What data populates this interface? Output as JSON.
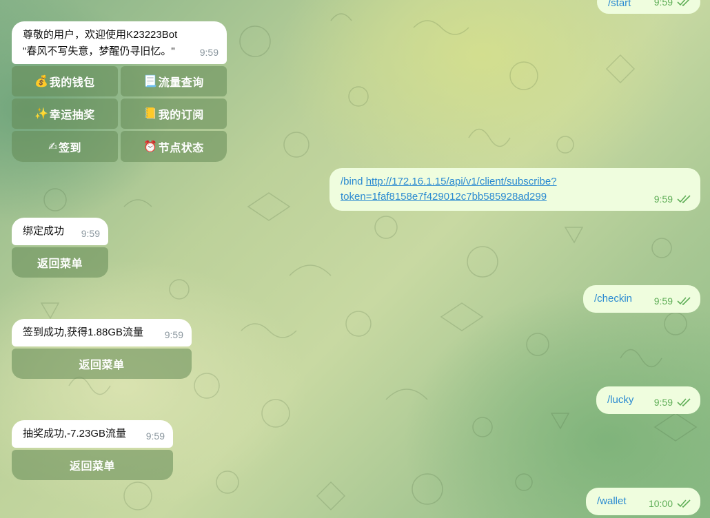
{
  "welcome": {
    "line1": "尊敬的用户，欢迎使用K23223Bot",
    "line2": "\"春风不写失意，梦醒仍寻旧忆。\"",
    "time": "9:59"
  },
  "menu": {
    "wallet": {
      "emoji": "💰",
      "label": "我的钱包"
    },
    "traffic": {
      "emoji": "📃",
      "label": "流量查询"
    },
    "lucky": {
      "emoji": "✨",
      "label": "幸运抽奖"
    },
    "subscription": {
      "emoji": "📒",
      "label": "我的订阅"
    },
    "checkin": {
      "emoji": "✍",
      "label": "签到"
    },
    "nodes": {
      "emoji": "⏰",
      "label": "节点状态"
    }
  },
  "messages": {
    "start": {
      "text": "/start",
      "time": "9:59"
    },
    "bind": {
      "prefix": "/bind ",
      "url_line1": "http://172.16.1.15/api/v1/client/subscribe?",
      "url_line2": "token=1faf8158e7f429012c7bb585928ad299",
      "time": "9:59"
    },
    "bind_ok": {
      "text": "绑定成功",
      "time": "9:59"
    },
    "checkin_cmd": {
      "text": "/checkin",
      "time": "9:59"
    },
    "checkin_ok": {
      "text": "签到成功,获得1.88GB流量",
      "time": "9:59"
    },
    "lucky_cmd": {
      "text": "/lucky",
      "time": "9:59"
    },
    "lucky_ok": {
      "text": "抽奖成功,-7.23GB流量",
      "time": "9:59"
    },
    "wallet_cmd": {
      "text": "/wallet",
      "time": "10:00"
    }
  },
  "back_label": "返回菜单",
  "colors": {
    "incoming_bubble": "#ffffff",
    "outgoing_bubble": "#effdde",
    "command_link": "#2a8ad1",
    "read_check": "#5fae57",
    "keyboard_button": "#648a56"
  },
  "icons": {
    "read_status": "double-check-icon"
  }
}
